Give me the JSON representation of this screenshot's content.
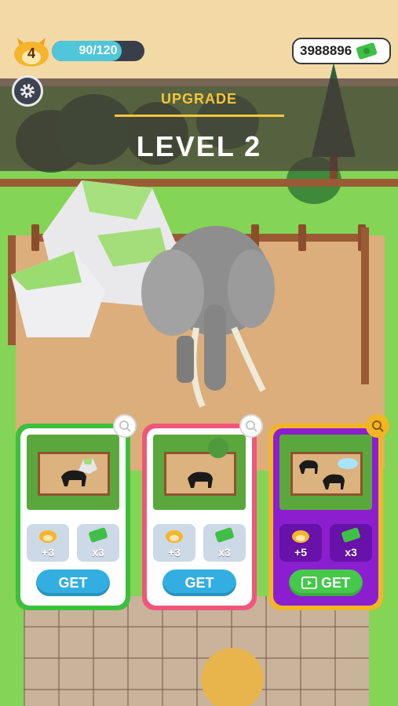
{
  "hud": {
    "level": "4",
    "xp_text": "90/120",
    "xp_fraction": 0.75,
    "currency_amount": "3988896"
  },
  "upgrade_banner": {
    "label": "UPGRADE",
    "level_title": "LEVEL 2"
  },
  "cards": [
    {
      "theme": "green",
      "border_color": "#3cbf3c",
      "reward_xp": "+3",
      "reward_cash": "x3",
      "button_label": "GET",
      "button_icon": ""
    },
    {
      "theme": "pink",
      "border_color": "#f0567a",
      "reward_xp": "+3",
      "reward_cash": "x3",
      "button_label": "GET",
      "button_icon": ""
    },
    {
      "theme": "purple",
      "border_color": "#f2b624",
      "reward_xp": "+5",
      "reward_cash": "x3",
      "button_label": "GET",
      "button_icon": "video-icon"
    }
  ],
  "colors": {
    "xp_fill": "#4fc6d9",
    "accent": "#f6c53c",
    "get_blue": "#33aee0",
    "get_green": "#46c84a",
    "purple_card": "#8b1fd0"
  }
}
